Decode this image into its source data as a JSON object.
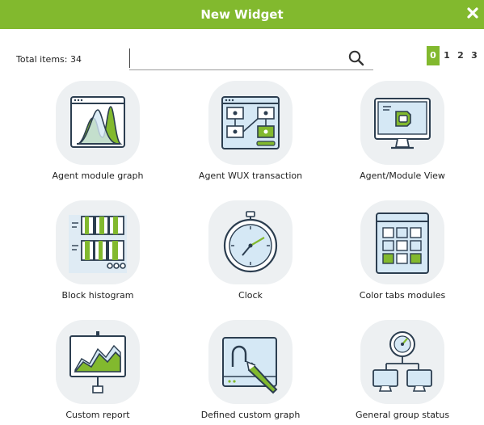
{
  "dialog": {
    "title": "New Widget"
  },
  "toolbar": {
    "total_label": "Total items: 34",
    "search_value": "",
    "pages": [
      "0",
      "1",
      "2",
      "3"
    ],
    "active_page": "0"
  },
  "widgets": [
    {
      "label": "Agent module graph"
    },
    {
      "label": "Agent WUX transaction"
    },
    {
      "label": "Agent/Module View"
    },
    {
      "label": "Block histogram"
    },
    {
      "label": "Clock"
    },
    {
      "label": "Color tabs modules"
    },
    {
      "label": "Custom report"
    },
    {
      "label": "Defined custom graph"
    },
    {
      "label": "General group status"
    }
  ],
  "colors": {
    "accent": "#82b92e",
    "outline": "#2c3e50",
    "light_blue": "#d5e8f5",
    "tile_bg": "#edf0f2"
  },
  "icons": {
    "close": "close-icon",
    "search": "search-icon"
  }
}
